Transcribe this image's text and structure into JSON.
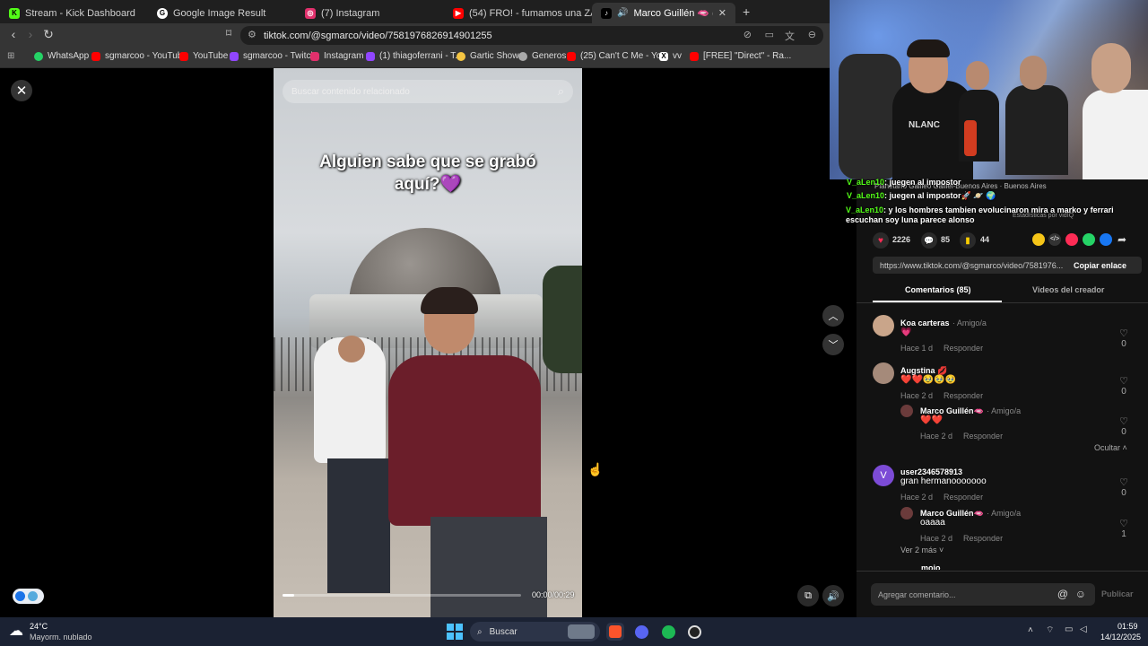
{
  "tabs": [
    {
      "title": "Stream - Kick Dashboard",
      "color": "#53fc18",
      "glyph": "K"
    },
    {
      "title": "Google Image Result",
      "color": "#ffffff",
      "glyph": "G"
    },
    {
      "title": "(7) Instagram",
      "color": "#e1306c",
      "glyph": "◎"
    },
    {
      "title": "(54) FRO! - fumamos una ZAZA - You",
      "color": "#ff0000",
      "glyph": "▶"
    },
    {
      "title": "Marco Guillén 🫦 (@sgmarco",
      "color": "#ffffff",
      "glyph": "♪"
    }
  ],
  "new_tab": "+",
  "address": {
    "url": "tiktok.com/@sgmarco/video/7581976826914901255"
  },
  "bookmarks": [
    {
      "label": "WhatsApp",
      "color": "#25d366"
    },
    {
      "label": "sgmarcoo - YouTube",
      "color": "#ff0000"
    },
    {
      "label": "YouTube",
      "color": "#ff0000"
    },
    {
      "label": "sgmarcoo - Twitch",
      "color": "#9146ff"
    },
    {
      "label": "Instagram",
      "color": "#e1306c"
    },
    {
      "label": "(1) thiagoferrani - T...",
      "color": "#9146ff"
    },
    {
      "label": "Gartic Show",
      "color": "#f5c542"
    },
    {
      "label": "Generos",
      "color": "#aaaaaa"
    },
    {
      "label": "(25) Can't C Me - Yo...",
      "color": "#ff0000"
    },
    {
      "label": "vv",
      "color": "#ffffff"
    },
    {
      "label": "[FREE] \"Direct\" - Ra...",
      "color": "#ff0000"
    }
  ],
  "video": {
    "search_placeholder": "Buscar contenido relacionado",
    "caption_line1": "Alguien sabe que se grabó",
    "caption_line2": "aquí?💜",
    "time": "00:00/00:29",
    "progress": 0.05
  },
  "stream_chat": [
    {
      "user": "V_aLen10",
      "msg": ": juegen al impostor"
    },
    {
      "user": "V_aLen10",
      "msg": ": juegen al impostor🚀 🪐 🌍"
    },
    {
      "user": "V_aLen10",
      "msg": ": y los hombres tambien evolucinaron mira a marko y ferrari escuchan soy luna parece alonso"
    }
  ],
  "stream_overlay": {
    "location": "Planetario Galileo Galilei-Buenos Aires · Buenos Aires",
    "stats": "Estadísticas por vidIQ",
    "shirt_text": "NLANC"
  },
  "actions": {
    "likes": "2226",
    "comments": "85",
    "saves": "44"
  },
  "share": {
    "link": "https://www.tiktok.com/@sgmarco/video/7581976...",
    "copy_label": "Copiar enlace"
  },
  "panel_tabs": {
    "comments": "Comentarios (85)",
    "creator_videos": "Videos del creador"
  },
  "comments": [
    {
      "name": "Koa carteras",
      "tag": "· Amigo/a",
      "text": "💗",
      "time": "Hace 1 d",
      "reply": "Responder",
      "likes": "0",
      "avatar": "#c9a58a"
    },
    {
      "name": "Augstina 💋",
      "tag": "",
      "text": "❤️❤️🥹🥹🥹",
      "time": "Hace 2 d",
      "reply": "Responder",
      "likes": "0",
      "avatar": "#a58a7a"
    },
    {
      "name": "Marco Guillén🫦",
      "tag": "· Amigo/a",
      "text": "❤️❤️",
      "time": "Hace 2 d",
      "reply": "Responder",
      "likes": "0",
      "avatar": "#6b3b3b"
    },
    {
      "name": "user2346578913",
      "tag": "",
      "text": "gran hermanooooooo",
      "time": "Hace 2 d",
      "reply": "Responder",
      "likes": "0",
      "avatar": "#7c4bd6",
      "initial": "V"
    },
    {
      "name": "Marco Guillén🫦",
      "tag": "· Amigo/a",
      "text": "oaaaa",
      "time": "Hace 2 d",
      "reply": "Responder",
      "likes": "1",
      "avatar": "#6b3b3b"
    }
  ],
  "hide_label": "Ocultar",
  "more_label": "Ver 2 más",
  "partial_name": "mojo",
  "comment_input": {
    "placeholder": "Agregar comentario...",
    "post": "Publicar"
  },
  "taskbar": {
    "temp": "24°C",
    "weather": "Mayorm. nublado",
    "search": "Buscar",
    "time": "01:59",
    "date": "14/12/2025"
  }
}
